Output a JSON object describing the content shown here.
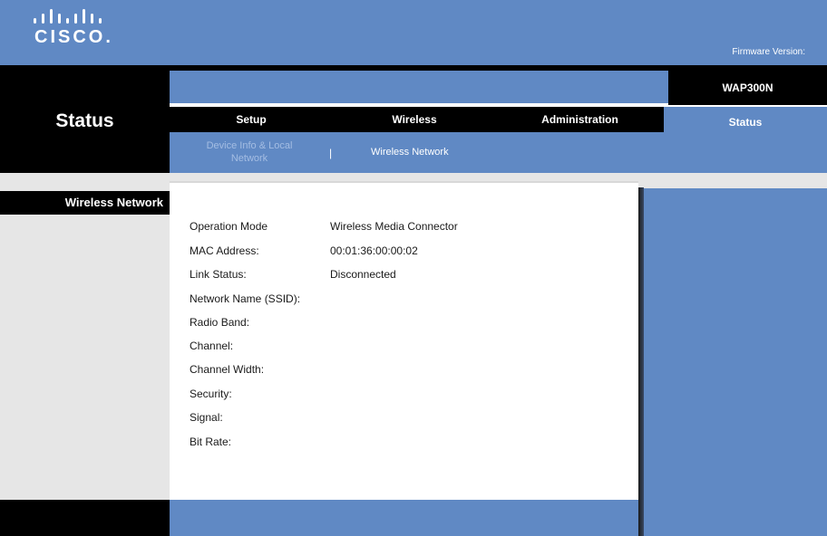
{
  "header": {
    "logo_text": "CISCO",
    "logo_period": ".",
    "firmware_label": "Firmware Version:"
  },
  "page_title": "Status",
  "model": "WAP300N",
  "tabs": [
    {
      "label": "Setup"
    },
    {
      "label": "Wireless"
    },
    {
      "label": "Administration"
    },
    {
      "label": "Status",
      "active": true
    }
  ],
  "subtabs": [
    {
      "label": "Device Info & Local Network"
    },
    {
      "label": "|"
    },
    {
      "label": "Wireless Network",
      "active": true
    }
  ],
  "section": {
    "label": "Wireless Network"
  },
  "fields": [
    {
      "label": "Operation Mode",
      "value": "Wireless Media Connector"
    },
    {
      "label": "MAC Address:",
      "value": "00:01:36:00:00:02"
    },
    {
      "label": "Link Status:",
      "value": "Disconnected"
    },
    {
      "label": "Network Name (SSID):",
      "value": ""
    },
    {
      "label": "Radio Band:",
      "value": ""
    },
    {
      "label": "Channel:",
      "value": ""
    },
    {
      "label": "Channel Width:",
      "value": ""
    },
    {
      "label": "Security:",
      "value": ""
    },
    {
      "label": "Signal:",
      "value": ""
    },
    {
      "label": "Bit Rate:",
      "value": ""
    }
  ],
  "colors": {
    "brand_blue": "#6089c4",
    "black": "#000000",
    "panel_gray": "#e6e6e6"
  }
}
